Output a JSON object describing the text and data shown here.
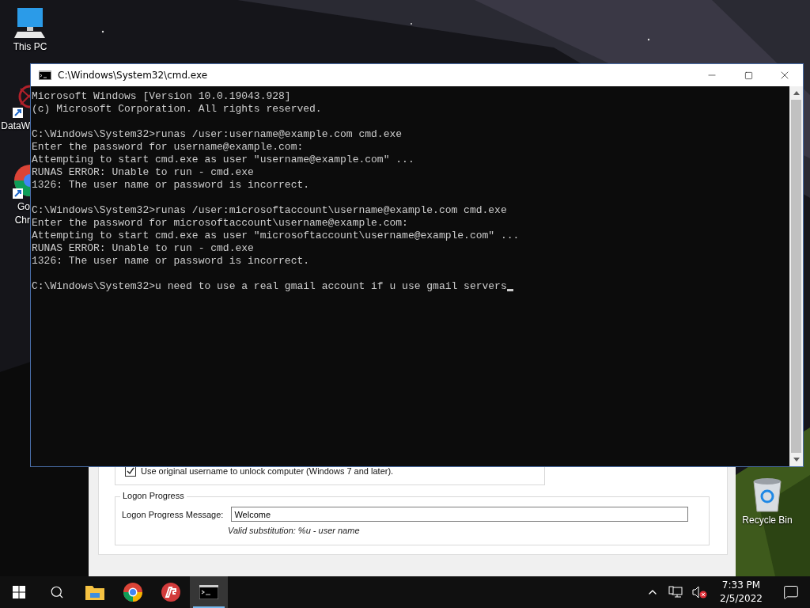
{
  "desktop_icons": [
    {
      "kind": "pc",
      "label": "This PC"
    },
    {
      "kind": "web",
      "label": "DataW"
    },
    {
      "kind": "chrome",
      "label": "Go",
      "label_2": "Chr"
    },
    {
      "kind": "bin",
      "label": "Recycle Bin"
    }
  ],
  "dialog": {
    "checkbox": {
      "label": "Use original username to unlock computer (Windows 7 and later).",
      "checked": true
    },
    "group": {
      "title": "Logon Progress",
      "field_label": "Logon Progress Message:",
      "value": "Welcome",
      "hint": "Valid substitution: %u - user name"
    }
  },
  "console": {
    "title": "C:\\Windows\\System32\\cmd.exe",
    "blocks": [
      [
        "Microsoft Windows [Version 10.0.19043.928]",
        "(c) Microsoft Corporation. All rights reserved."
      ],
      [
        "C:\\Windows\\System32>runas /user:username@example.com cmd.exe",
        "Enter the password for username@example.com:",
        "Attempting to start cmd.exe as user \"username@example.com\" ...",
        "RUNAS ERROR: Unable to run - cmd.exe",
        "1326: The user name or password is incorrect."
      ],
      [
        "C:\\Windows\\System32>runas /user:microsoftaccount\\username@example.com cmd.exe",
        "Enter the password for microsoftaccount\\username@example.com:",
        "Attempting to start cmd.exe as user \"microsoftaccount\\username@example.com\" ...",
        "RUNAS ERROR: Unable to run - cmd.exe",
        "1326: The user name or password is incorrect."
      ],
      [
        "C:\\Windows\\System32>u need to use a real gmail account if u use gmail servers"
      ]
    ],
    "cursor": true
  },
  "taskbar": {
    "apps": [
      {
        "kind": "explorer",
        "active": false
      },
      {
        "kind": "chrome",
        "active": false
      },
      {
        "kind": "red-app",
        "active": false
      },
      {
        "kind": "console",
        "active": true
      }
    ],
    "time": "7:33 PM",
    "date": "2/5/2022"
  }
}
